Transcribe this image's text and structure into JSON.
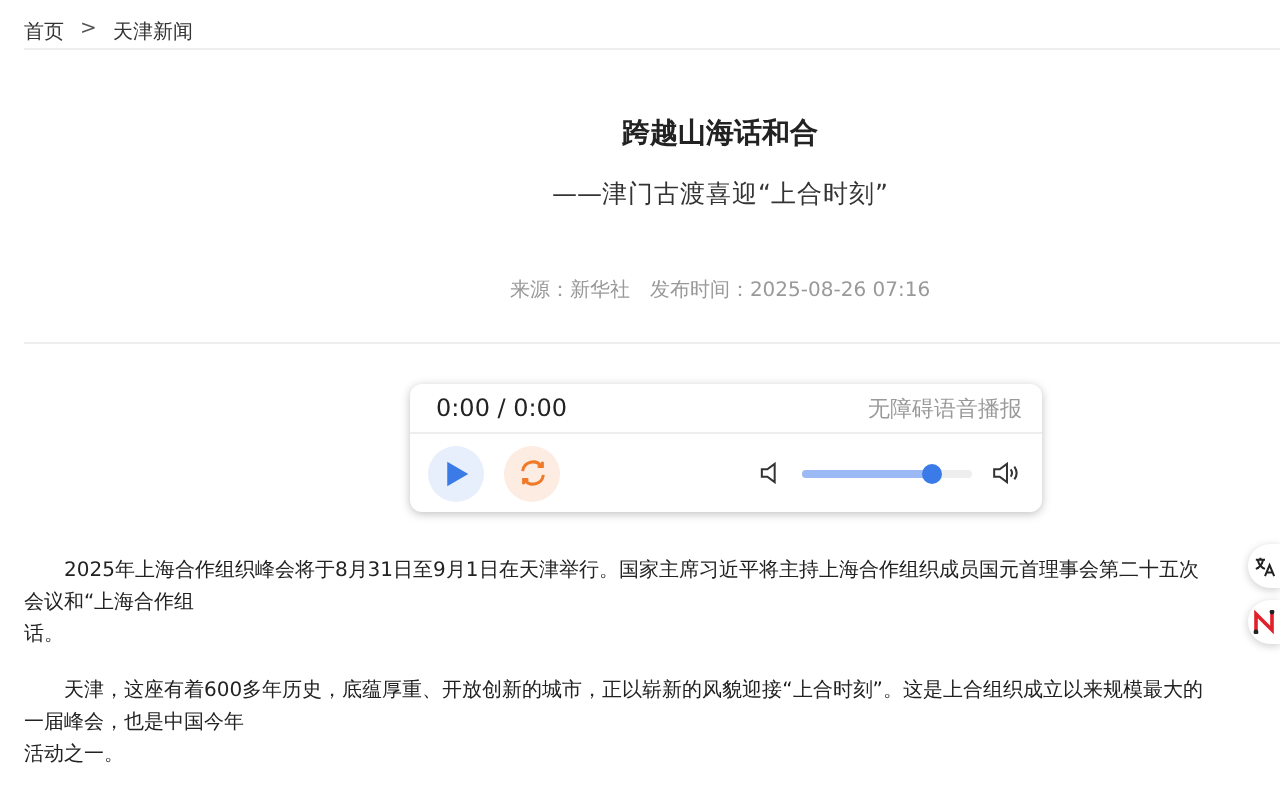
{
  "breadcrumb": {
    "items": [
      "首页",
      "天津新闻"
    ],
    "separator": ">"
  },
  "article": {
    "title": "跨越山海话和合",
    "subtitle": "——津门古渡喜迎“上合时刻”",
    "source": "来源：新华社",
    "published": "发布时间：2025-08-26 07:16"
  },
  "audio_player": {
    "time": "0:00 / 0:00",
    "label": "无障碍语音播报",
    "playing": false,
    "volume": {
      "level": 0.76
    }
  },
  "paragraphs": [
    {
      "lines": [
        "2025年上海合作组织峰会将于8月31日至9月1日在天津举行。国家主席习近平将主持上海合作组织成员国元首理事会第二十五次会议和“上海合作组",
        "话。"
      ]
    },
    {
      "lines": [
        "天津，这座有着600多年历史，底蕴厚重、开放创新的城市，正以崭新的风貌迎接“上合时刻”。这是上合组织成立以来规模最大的一届峰会，也是中国今年",
        "活动之一。"
      ]
    }
  ]
}
